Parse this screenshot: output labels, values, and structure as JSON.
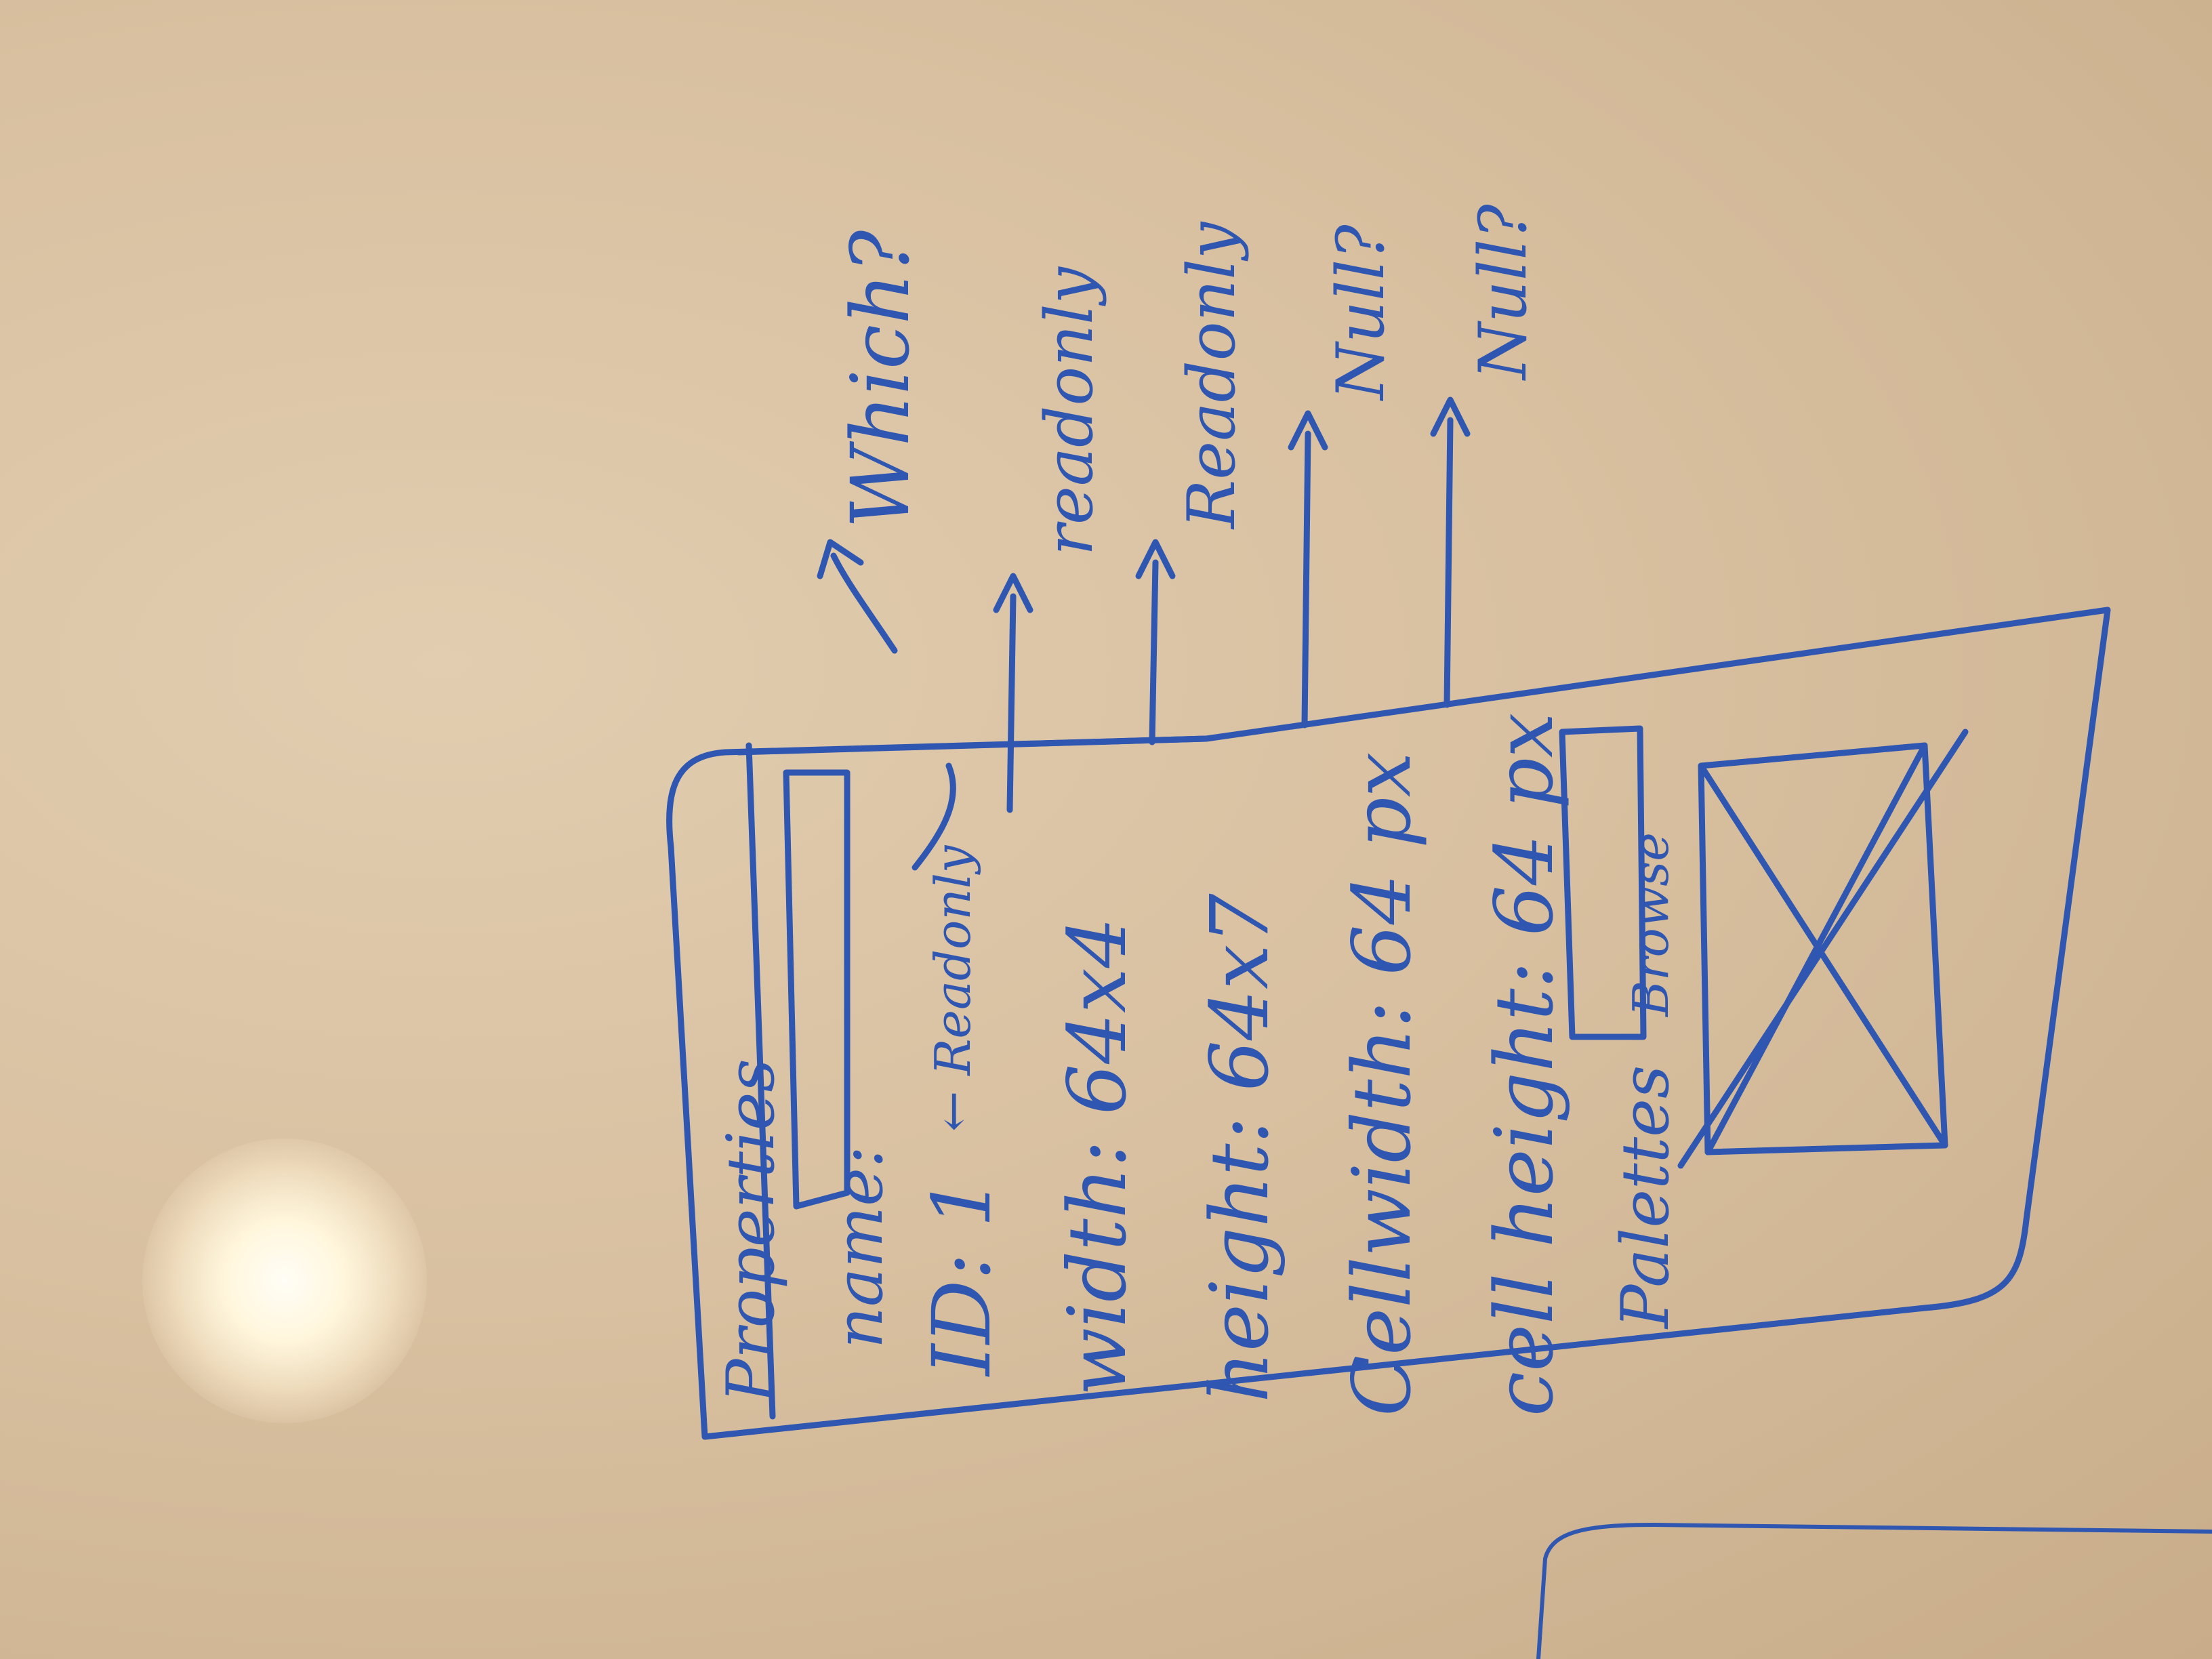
{
  "whiteboard": {
    "panel": {
      "title": "Properties",
      "rows": [
        {
          "label": "name:",
          "value": ""
        },
        {
          "label": "ID: 1",
          "note": "← Readonly"
        },
        {
          "label": "width: 64x4"
        },
        {
          "label": "height: 64x7"
        },
        {
          "label": "Cellwidth: 64 px"
        },
        {
          "label": "cell height: 64 px"
        },
        {
          "label": "Palettes",
          "button": "Browse"
        }
      ]
    },
    "annotations": {
      "question": "Which?",
      "width_note": "readonly",
      "height_note": "Readonly",
      "cellwidth_note": "Null?",
      "cellheight_note": "Null?"
    },
    "ink_color": "#2f56b0",
    "board_color": "#d8c0a0"
  }
}
